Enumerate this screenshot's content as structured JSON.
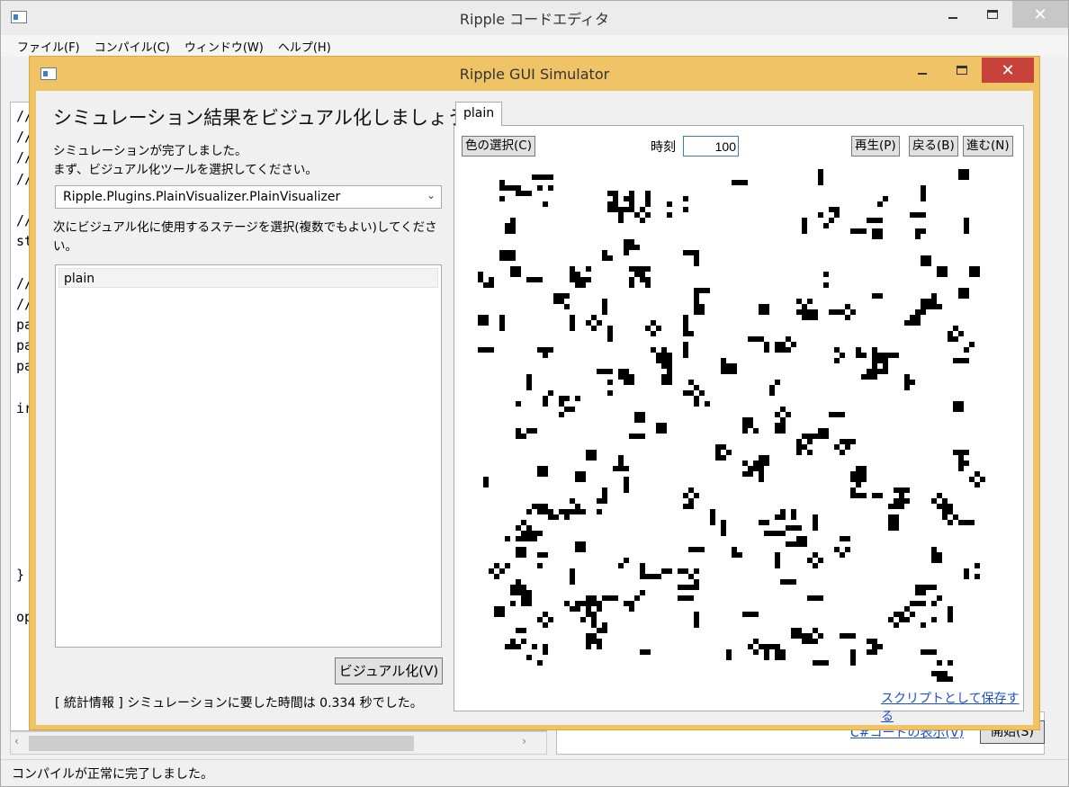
{
  "main_window": {
    "title": "Ripple コードエディタ",
    "menu": [
      "ファイル(F)",
      "コンパイル(C)",
      "ウィンドウ(W)",
      "ヘルプ(H)"
    ],
    "code_lines": [
      "//",
      "//",
      "//",
      "//",
      "",
      "//",
      "st",
      "",
      "//",
      "//",
      "pa",
      "pa",
      "pa",
      "",
      "ir",
      "",
      "",
      "",
      "",
      "",
      "",
      "",
      "}",
      "",
      "op"
    ],
    "show_code_link": "C#コードの表示(V)",
    "start_button": "開始(S)",
    "status": "コンパイルが正常に完了しました。"
  },
  "simulator": {
    "title": "Ripple GUI Simulator",
    "heading": "シミュレーション結果をビジュアル化しましょう",
    "status_line_1": "シミュレーションが完了しました。",
    "status_line_2": "まず、ビジュアル化ツールを選択してください。",
    "visualizer": "Ripple.Plugins.PlainVisualizer.PlainVisualizer",
    "stage_instruction": "次にビジュアル化に使用するステージを選択(複数でもよい)してください。",
    "stages": [
      "plain"
    ],
    "visualize_button": "ビジュアル化(V)",
    "stats": "[ 統計情報 ] シミュレーションに要した時間は 0.334 秒でした。",
    "tab": "plain",
    "color_button": "色の選択(C)",
    "time_label": "時刻",
    "time_value": "100",
    "play_button": "再生(P)",
    "back_button": "戻る(B)",
    "forward_button": "進む(N)",
    "save_script_link": "スクリプトとして保存する"
  },
  "colors": {
    "sim_frame": "#f0c466",
    "close_button": "#c7423a",
    "link": "#1a4fd1",
    "cell_alive": "#000000",
    "cell_dead": "#ffffff"
  }
}
